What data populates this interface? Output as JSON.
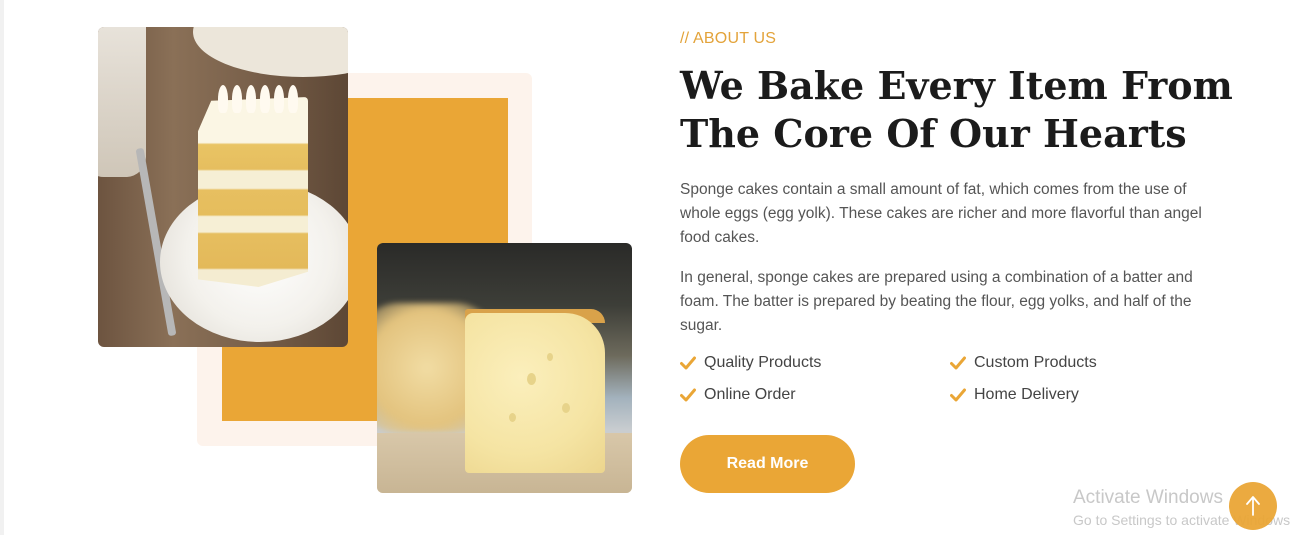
{
  "about": {
    "eyebrow": "// ABOUT US",
    "headline_line1": "We Bake Every Item From",
    "headline_line2": "The Core Of Our Hearts",
    "paragraph1": "Sponge cakes contain a small amount of fat, which comes from the use of whole eggs (egg yolk). These cakes are richer and more flavorful than angel food cakes.",
    "paragraph2": "In general, sponge cakes are prepared using a combination of a batter and foam. The batter is prepared by beating the flour, egg yolks, and half of the sugar.",
    "features": [
      "Quality Products",
      "Custom Products",
      "Online Order",
      "Home Delivery"
    ],
    "feature_icon": "check-icon",
    "button_label": "Read More"
  },
  "images": {
    "primary": "cake-slice-photo",
    "secondary": "sponge-cake-photo"
  },
  "windows_watermark": {
    "title": "Activate Windows",
    "subtitle": "Go to Settings to activate Windows"
  },
  "scroll_top_icon": "arrow-up-icon",
  "colors": {
    "accent": "#eaa636",
    "accent_light": "#fdf3ec",
    "heading": "#1b1b1b",
    "body_text": "#555555"
  }
}
